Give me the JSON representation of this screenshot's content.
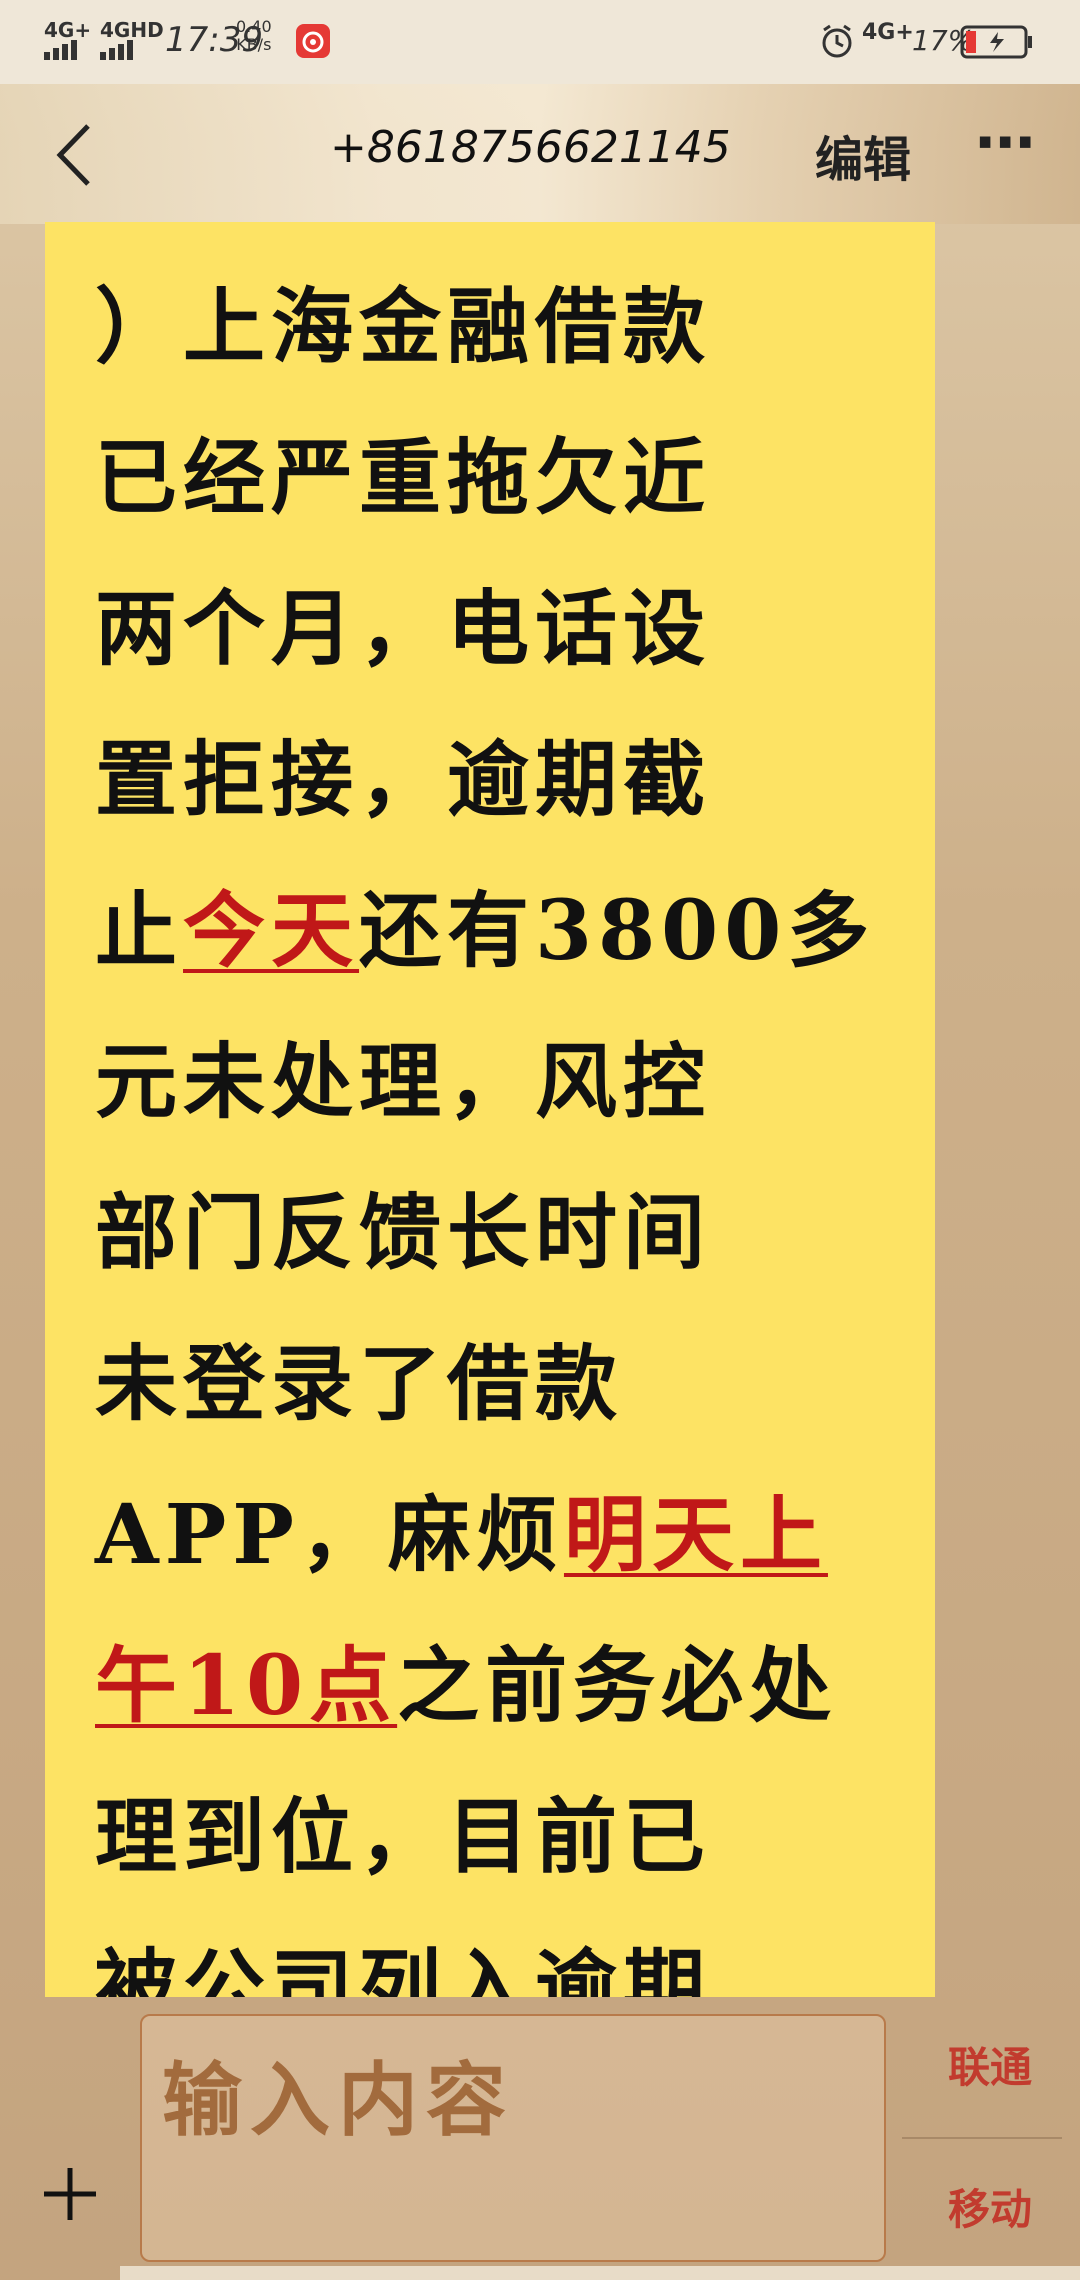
{
  "status_bar": {
    "net1": "4G+",
    "net2": "4GHD",
    "time": "17:39",
    "speed_value": "0.40",
    "speed_unit": "KB/s",
    "net3": "4G+",
    "battery": "17%"
  },
  "header": {
    "title": "+8618756621145",
    "edit_label": "编辑",
    "more_label": "⋯"
  },
  "message": {
    "lines": [
      [
        "）上海金融借款",
        null
      ],
      [
        "已经严重拖欠近",
        null
      ],
      [
        "两个月，电话设",
        null
      ],
      [
        "置拒接，逾期截",
        null
      ],
      [
        "止",
        "今天",
        "还有3800多"
      ],
      [
        "元未处理，风控",
        null
      ],
      [
        "部门反馈长时间",
        null
      ],
      [
        "未登录了借款",
        null
      ],
      [
        "APP，麻烦",
        "明天上",
        ""
      ],
      [
        "",
        "午10点",
        "之前务必处"
      ],
      [
        "理到位，目前已",
        null
      ],
      [
        "被公司列入逾期",
        null
      ]
    ]
  },
  "composer": {
    "placeholder": "输入内容",
    "sim1": "联通",
    "sim2": "移动"
  },
  "colors": {
    "message_bg": "#fde364",
    "highlight": "#c01818",
    "placeholder": "#a26b3d",
    "sim_label": "#c23b2e"
  }
}
